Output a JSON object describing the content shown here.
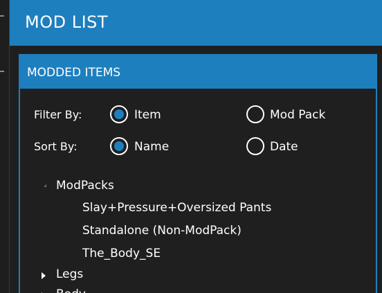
{
  "window": {
    "title": "MOD LIST"
  },
  "panel": {
    "title": "MODDED ITEMS",
    "filter": {
      "label": "Filter By:",
      "options": [
        {
          "label": "Item",
          "selected": true
        },
        {
          "label": "Mod Pack",
          "selected": false
        }
      ]
    },
    "sort": {
      "label": "Sort By:",
      "options": [
        {
          "label": "Name",
          "selected": true
        },
        {
          "label": "Date",
          "selected": false
        }
      ]
    },
    "tree": {
      "nodes": [
        {
          "label": "ModPacks",
          "expanded": true,
          "children": [
            "Slay+Pressure+Oversized Pants",
            "Standalone (Non-ModPack)",
            "The_Body_SE"
          ]
        },
        {
          "label": "Legs",
          "expanded": false
        },
        {
          "label": "Body",
          "expanded": false
        }
      ]
    }
  },
  "colors": {
    "accent": "#1e7fbe",
    "background": "#1f1f1f",
    "text": "#ffffff"
  }
}
